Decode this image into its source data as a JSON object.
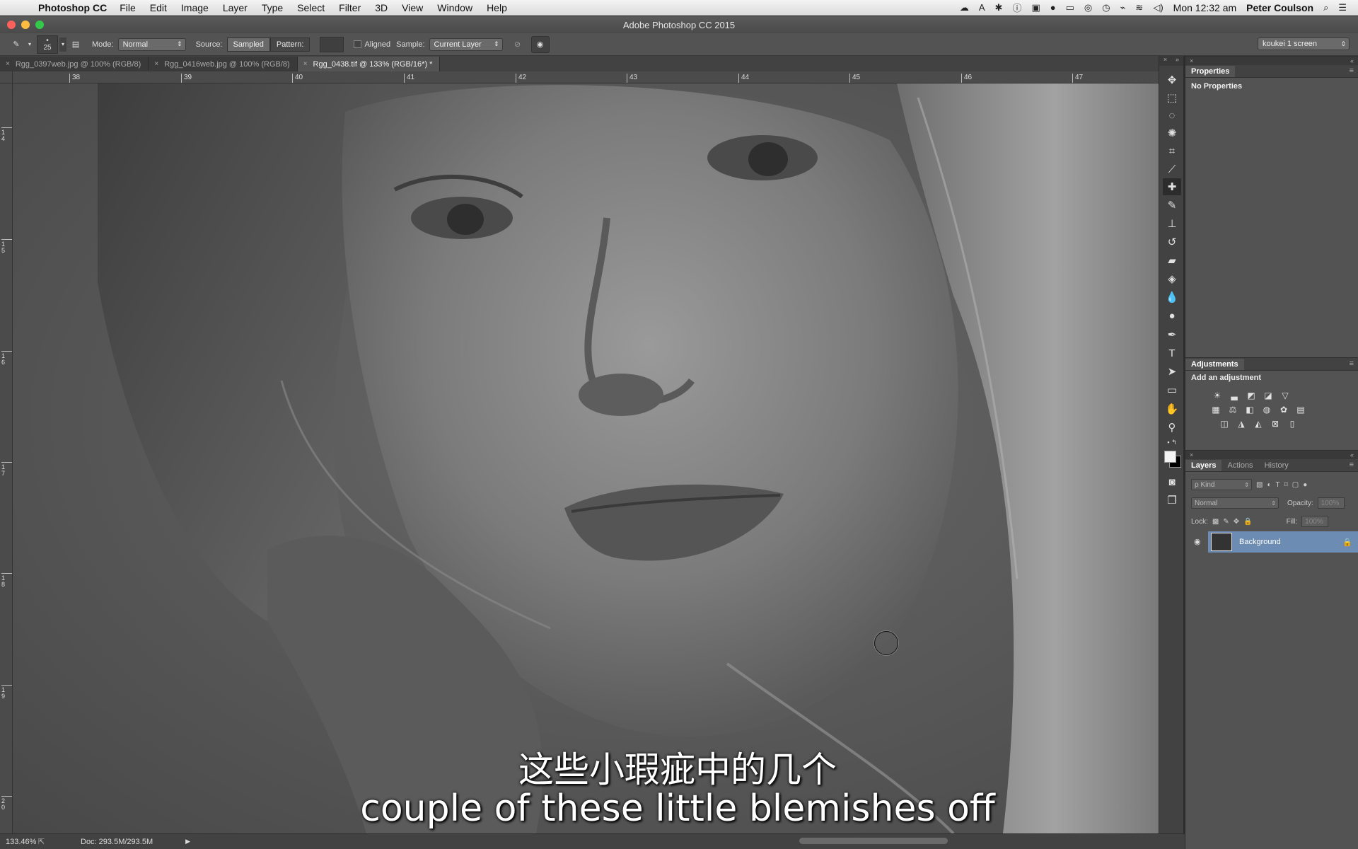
{
  "menubar": {
    "apple": "",
    "app_name": "Photoshop CC",
    "items": [
      "File",
      "Edit",
      "Image",
      "Layer",
      "Type",
      "Select",
      "Filter",
      "3D",
      "View",
      "Window",
      "Help"
    ],
    "clock": "Mon 12:32 am",
    "user": "Peter Coulson"
  },
  "window": {
    "title": "Adobe Photoshop CC 2015"
  },
  "options": {
    "brush_size": "25",
    "mode_label": "Mode:",
    "mode_value": "Normal",
    "source_label": "Source:",
    "source_sampled": "Sampled",
    "source_pattern": "Pattern:",
    "aligned_label": "Aligned",
    "sample_label": "Sample:",
    "sample_value": "Current Layer",
    "workspace": "koukei 1 screen"
  },
  "tabs": [
    {
      "label": "Rgg_0397web.jpg @ 100% (RGB/8)",
      "active": false
    },
    {
      "label": "Rgg_0416web.jpg @ 100% (RGB/8)",
      "active": false
    },
    {
      "label": "Rgg_0438.tif @ 133% (RGB/16*) *",
      "active": true
    }
  ],
  "ruler_h": [
    "38",
    "39",
    "40",
    "41",
    "42",
    "43",
    "44",
    "45",
    "46",
    "47"
  ],
  "ruler_v": [
    "1\n4",
    "1\n5",
    "1\n6",
    "1\n7",
    "1\n8",
    "1\n9",
    "2\n0"
  ],
  "subtitles": {
    "chinese": "这些小瑕疵中的几个",
    "english": "couple of these little blemishes off"
  },
  "status": {
    "zoom": "133.46%",
    "doc": "Doc: 293.5M/293.5M"
  },
  "properties": {
    "title": "Properties",
    "body": "No Properties"
  },
  "adjustments": {
    "title": "Adjustments",
    "add_label": "Add an adjustment"
  },
  "layers": {
    "tabs": [
      "Layers",
      "Actions",
      "History"
    ],
    "kind_label": "ρ Kind",
    "blend_mode": "Normal",
    "opacity_label": "Opacity:",
    "opacity_value": "100%",
    "lock_label": "Lock:",
    "fill_label": "Fill:",
    "fill_value": "100%",
    "items": [
      {
        "name": "Background"
      }
    ]
  },
  "colors": {
    "accent_selection": "#6d8cb3",
    "panel_bg": "#535353",
    "foreground": "#f4f4f4",
    "background": "#000000"
  }
}
